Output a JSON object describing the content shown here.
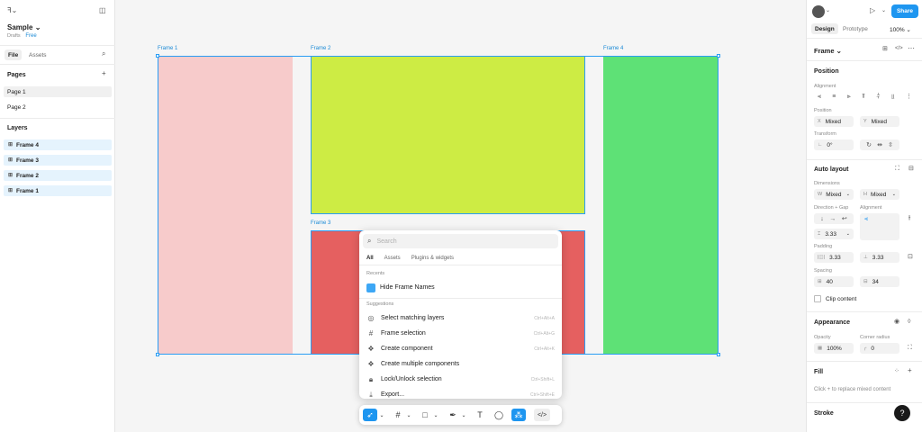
{
  "file": {
    "name": "Sample",
    "location": "Drafts",
    "plan": "Free"
  },
  "left_tabs": [
    "File",
    "Assets"
  ],
  "pages": {
    "title": "Pages",
    "items": [
      "Page 1",
      "Page 2"
    ]
  },
  "layers": {
    "title": "Layers",
    "items": [
      "Frame 4",
      "Frame 3",
      "Frame 2",
      "Frame 1"
    ]
  },
  "canvas": {
    "frame_labels": [
      "Frame 1",
      "Frame 2",
      "Frame 3",
      "Frame 4"
    ],
    "colors": {
      "frame1": "#f7cbcb",
      "frame2": "#cdec44",
      "frame3": "#e56060",
      "frame4": "#5ee176",
      "selection": "#2a9df4"
    }
  },
  "menu": {
    "search_placeholder": "Search",
    "tabs": [
      "All",
      "Assets",
      "Plugins & widgets"
    ],
    "recents_title": "Recents",
    "recent_item": "Hide Frame Names",
    "suggestions_title": "Suggestions",
    "suggestions": [
      {
        "label": "Select matching layers",
        "shortcut": "Ctrl+Alt+A"
      },
      {
        "label": "Frame selection",
        "shortcut": "Ctrl+Alt+G"
      },
      {
        "label": "Create component",
        "shortcut": "Ctrl+Alt+K"
      },
      {
        "label": "Create multiple components",
        "shortcut": ""
      },
      {
        "label": "Lock/Unlock selection",
        "shortcut": "Ctrl+Shift+L"
      },
      {
        "label": "Export...",
        "shortcut": "Ctrl+Shift+E"
      }
    ]
  },
  "right": {
    "tabs": [
      "Design",
      "Prototype"
    ],
    "zoom": "100%",
    "share": "Share",
    "frame_label": "Frame",
    "position": {
      "title": "Position",
      "alignment": "Alignment",
      "position": "Position",
      "x": "Mixed",
      "y": "Mixed",
      "transform": "Transform",
      "rotation": "0°"
    },
    "autolayout": {
      "title": "Auto layout",
      "dimensions": "Dimensions",
      "w": "Mixed",
      "h": "Mixed",
      "direction_gap": "Direction + Gap",
      "alignment": "Alignment",
      "gap": "3.33",
      "padding": "Padding",
      "pad_h": "3.33",
      "pad_v": "3.33",
      "spacing": "Spacing",
      "sp_h": "40",
      "sp_v": "34",
      "clip": "Clip content"
    },
    "appearance": {
      "title": "Appearance",
      "opacity_label": "Opacity",
      "radius_label": "Corner radius",
      "opacity": "100%",
      "radius": "0"
    },
    "fill": {
      "title": "Fill",
      "hint": "Click + to replace mixed content"
    },
    "stroke": {
      "title": "Stroke"
    },
    "help": "?"
  }
}
